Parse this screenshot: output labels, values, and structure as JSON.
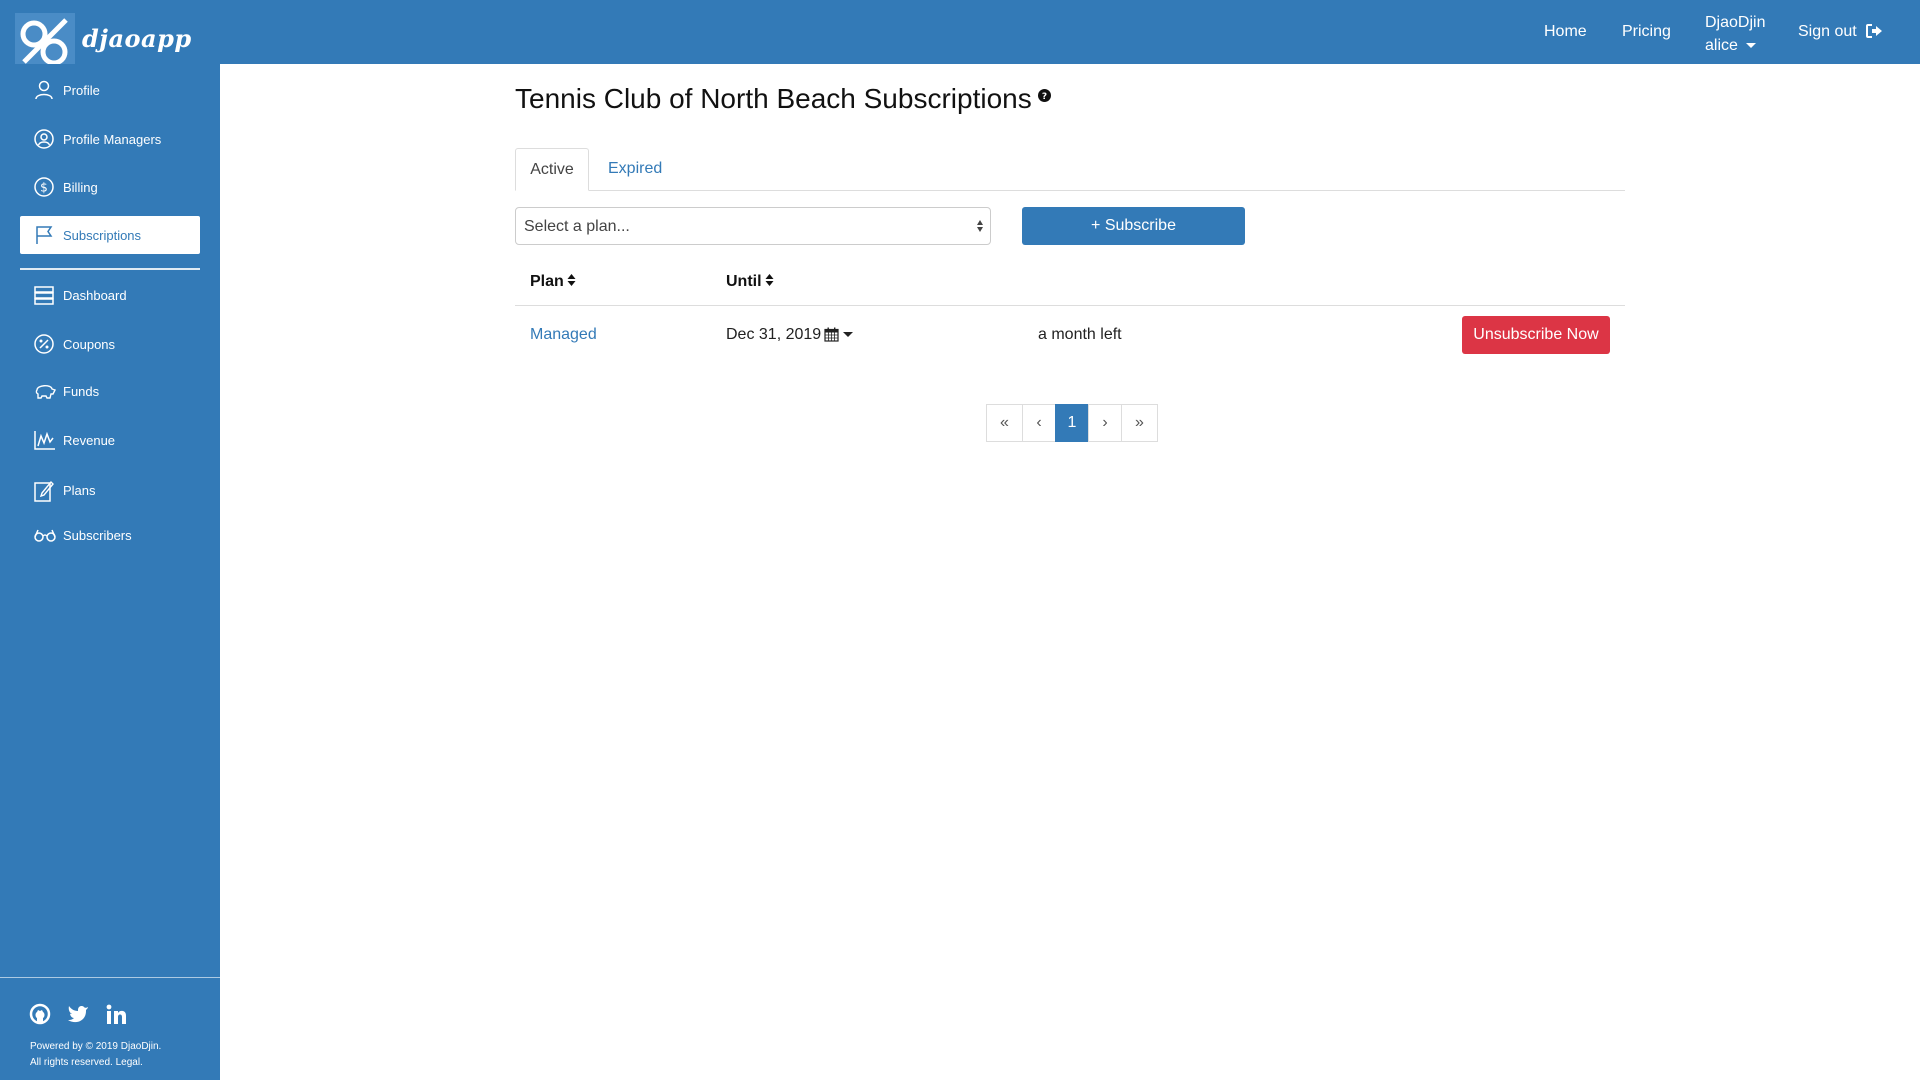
{
  "brand": {
    "name": "djaoapp"
  },
  "topnav": {
    "home": "Home",
    "pricing": "Pricing",
    "org": "DjaoDjin",
    "user": "alice",
    "signout": "Sign out"
  },
  "sidebar": {
    "items": [
      {
        "label": "Profile",
        "icon": "user-icon"
      },
      {
        "label": "Profile Managers",
        "icon": "user-circle-icon"
      },
      {
        "label": "Billing",
        "icon": "dollar-icon"
      },
      {
        "label": "Subscriptions",
        "icon": "flag-icon",
        "active": true
      },
      {
        "label": "Dashboard",
        "icon": "server-icon"
      },
      {
        "label": "Coupons",
        "icon": "percent-icon"
      },
      {
        "label": "Funds",
        "icon": "piggy-bank-icon"
      },
      {
        "label": "Revenue",
        "icon": "chart-icon"
      },
      {
        "label": "Plans",
        "icon": "edit-icon"
      },
      {
        "label": "Subscribers",
        "icon": "glasses-icon"
      }
    ],
    "footer": {
      "line1": "Powered by © 2019 DjaoDjin.",
      "line2": "All rights reserved. Legal."
    }
  },
  "page": {
    "title": "Tennis Club of North Beach Subscriptions",
    "tabs": {
      "active": "Active",
      "expired": "Expired"
    },
    "select_placeholder": "Select a plan...",
    "subscribe_label": "+ Subscribe",
    "table": {
      "headers": {
        "plan": "Plan",
        "until": "Until"
      },
      "rows": [
        {
          "plan": "Managed",
          "until": "Dec 31, 2019",
          "remaining": "a month left",
          "action": "Unsubscribe Now"
        }
      ]
    },
    "pagination": [
      "«",
      "‹",
      "1",
      "›",
      "»"
    ],
    "current_page": "1"
  },
  "colors": {
    "primary": "#337ab7",
    "danger": "#dc3545"
  }
}
